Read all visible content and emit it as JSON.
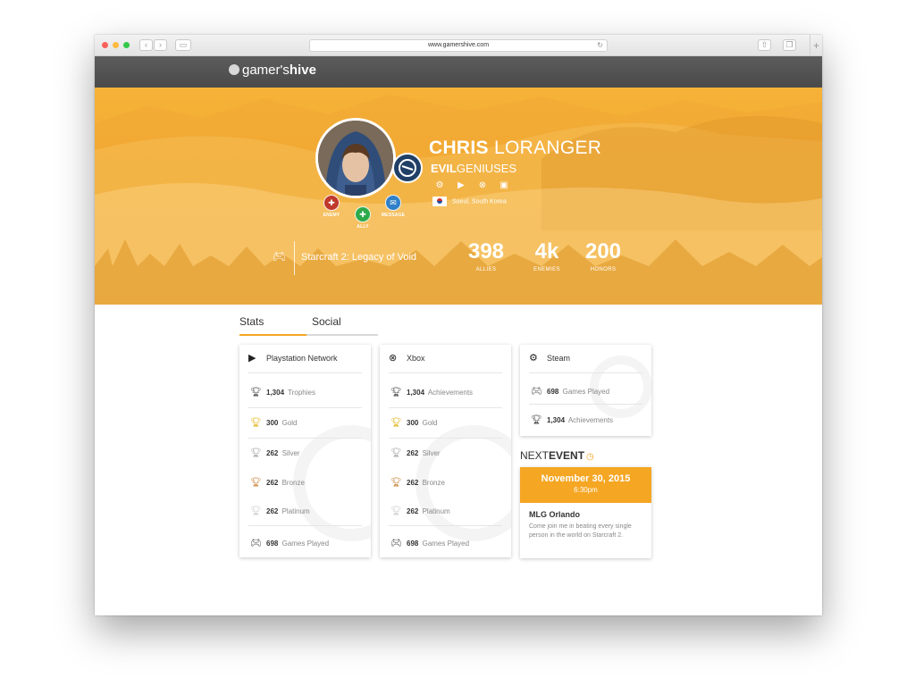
{
  "browser": {
    "url": "www.gamershive.com",
    "back_icon": "chevron-left",
    "forward_icon": "chevron-right"
  },
  "site": {
    "logo_light": "gamer's",
    "logo_bold": "hive"
  },
  "profile": {
    "first_name": "CHRIS",
    "last_name": "LORANGER",
    "team_bold": "EVIL",
    "team_light": "GENIUSES",
    "location": "Soeul, South Korea",
    "actions": {
      "enemy": "ENEMY",
      "ally": "ALLY",
      "message": "MESSAGE"
    },
    "action_colors": {
      "enemy": "#c0392b",
      "ally": "#2eaa4a",
      "message": "#2f80c8"
    },
    "game": "Starcraft 2: Legacy of Void",
    "stats": [
      {
        "value": "398",
        "label": "ALLIES"
      },
      {
        "value": "4k",
        "label": "ENEMIES"
      },
      {
        "value": "200",
        "label": "HONORS"
      }
    ]
  },
  "tabs": {
    "stats": "Stats",
    "social": "Social"
  },
  "psn": {
    "title": "Playstation Network",
    "rows": [
      {
        "value": "1,304",
        "label": "Trophies"
      },
      {
        "value": "300",
        "label": "Gold"
      },
      {
        "value": "262",
        "label": "Silver"
      },
      {
        "value": "262",
        "label": "Bronze"
      },
      {
        "value": "262",
        "label": "Platinum"
      },
      {
        "value": "698",
        "label": "Games Played"
      }
    ]
  },
  "xbox": {
    "title": "Xbox",
    "rows": [
      {
        "value": "1,304",
        "label": "Achievements"
      },
      {
        "value": "300",
        "label": "Gold"
      },
      {
        "value": "262",
        "label": "Silver"
      },
      {
        "value": "262",
        "label": "Bronze"
      },
      {
        "value": "262",
        "label": "Platinum"
      },
      {
        "value": "698",
        "label": "Games Played"
      }
    ]
  },
  "steam": {
    "title": "Steam",
    "rows": [
      {
        "value": "698",
        "label": "Games Played"
      },
      {
        "value": "1,304",
        "label": "Achievements"
      }
    ]
  },
  "next_event": {
    "heading_light": "NEXT",
    "heading_bold": "EVENT",
    "date": "November 30, 2015",
    "time": "6:30pm",
    "name": "MLG Orlando",
    "description": "Come join me in beating every single person in the world on Starcraft 2."
  },
  "colors": {
    "accent": "#f5a623",
    "gold": "#e2b51c",
    "silver": "#a8a8a8",
    "bronze": "#c8863c",
    "platinum": "#cfcfcf"
  }
}
